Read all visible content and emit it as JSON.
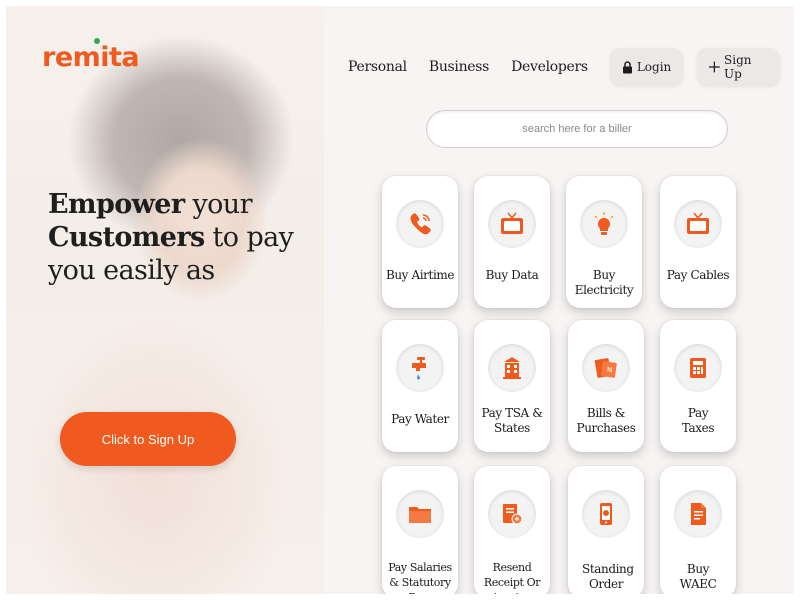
{
  "brand": {
    "logo_text": "remita",
    "accent": "#f05a1e",
    "dot_color": "#3aa64a"
  },
  "nav": {
    "links": [
      "Personal",
      "Business",
      "Developers"
    ],
    "login_label": "Login",
    "signup_label": "Sign Up"
  },
  "hero": {
    "line1_bold": "Empower",
    "line1_rest": " your",
    "line2_bold": "Customers",
    "line2_rest": " to pay",
    "line3": "you easily as",
    "cta_label": "Click to Sign Up"
  },
  "search": {
    "placeholder": "search here for a biller",
    "value": ""
  },
  "services": [
    {
      "label": "Buy Airtime",
      "icon": "phone-icon"
    },
    {
      "label": "Buy Data",
      "icon": "tv-icon"
    },
    {
      "label": "Buy Electricity",
      "icon": "bulb-icon"
    },
    {
      "label": "Pay Cables",
      "icon": "tv-icon"
    },
    {
      "label": "Pay Water",
      "icon": "tap-icon"
    },
    {
      "label": "Pay TSA & States",
      "icon": "building-icon"
    },
    {
      "label": "Bills & Purchases",
      "icon": "bill-icon"
    },
    {
      "label": "Pay Taxes",
      "icon": "tax-icon"
    },
    {
      "label": "Pay Salaries & Statutory Pay..",
      "icon": "folder-icon"
    },
    {
      "label": "Resend Receipt Or invoice",
      "icon": "receipt-icon"
    },
    {
      "label": "Standing Order",
      "icon": "mobile-icon"
    },
    {
      "label": "Buy WAEC",
      "icon": "document-icon"
    }
  ]
}
